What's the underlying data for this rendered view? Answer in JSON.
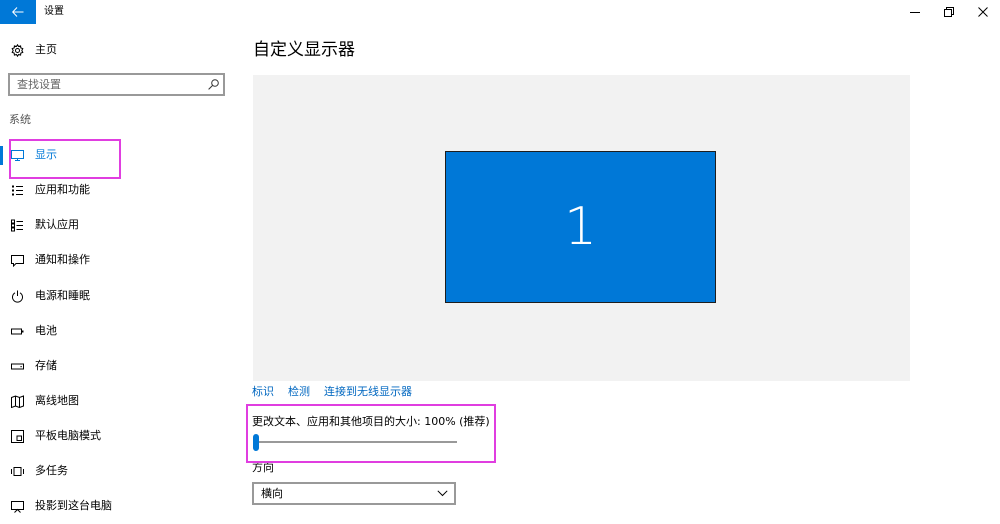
{
  "window": {
    "title": "设置",
    "back_icon": "back-arrow-icon",
    "controls": [
      "minimize-icon",
      "restore-icon",
      "close-icon"
    ]
  },
  "sidebar": {
    "home": {
      "label": "主页",
      "icon": "gear-icon"
    },
    "search": {
      "placeholder": "查找设置",
      "icon": "search-icon"
    },
    "section_label": "系统",
    "items": [
      {
        "label": "显示",
        "icon": "monitor-icon",
        "selected": true
      },
      {
        "label": "应用和功能",
        "icon": "apps-list-icon",
        "selected": false
      },
      {
        "label": "默认应用",
        "icon": "default-apps-icon",
        "selected": false
      },
      {
        "label": "通知和操作",
        "icon": "notification-icon",
        "selected": false
      },
      {
        "label": "电源和睡眠",
        "icon": "power-icon",
        "selected": false
      },
      {
        "label": "电池",
        "icon": "battery-icon",
        "selected": false
      },
      {
        "label": "存储",
        "icon": "storage-icon",
        "selected": false
      },
      {
        "label": "离线地图",
        "icon": "offline-map-icon",
        "selected": false
      },
      {
        "label": "平板电脑模式",
        "icon": "tablet-mode-icon",
        "selected": false
      },
      {
        "label": "多任务",
        "icon": "multitasking-icon",
        "selected": false
      },
      {
        "label": "投影到这台电脑",
        "icon": "project-icon",
        "selected": false
      }
    ]
  },
  "main": {
    "title": "自定义显示器",
    "display_number": "1",
    "links": [
      {
        "label": "标识"
      },
      {
        "label": "检测"
      },
      {
        "label": "连接到无线显示器"
      }
    ],
    "scale": {
      "label": "更改文本、应用和其他项目的大小: 100% (推荐)",
      "slider_level": 0
    },
    "orientation": {
      "label": "方向",
      "value": "横向",
      "icon": "chevron-down-icon"
    }
  },
  "colors": {
    "accent": "#0078d7",
    "link": "#0067c0",
    "annotation": "#e03ee0",
    "canvas": "#f2f2f2"
  }
}
